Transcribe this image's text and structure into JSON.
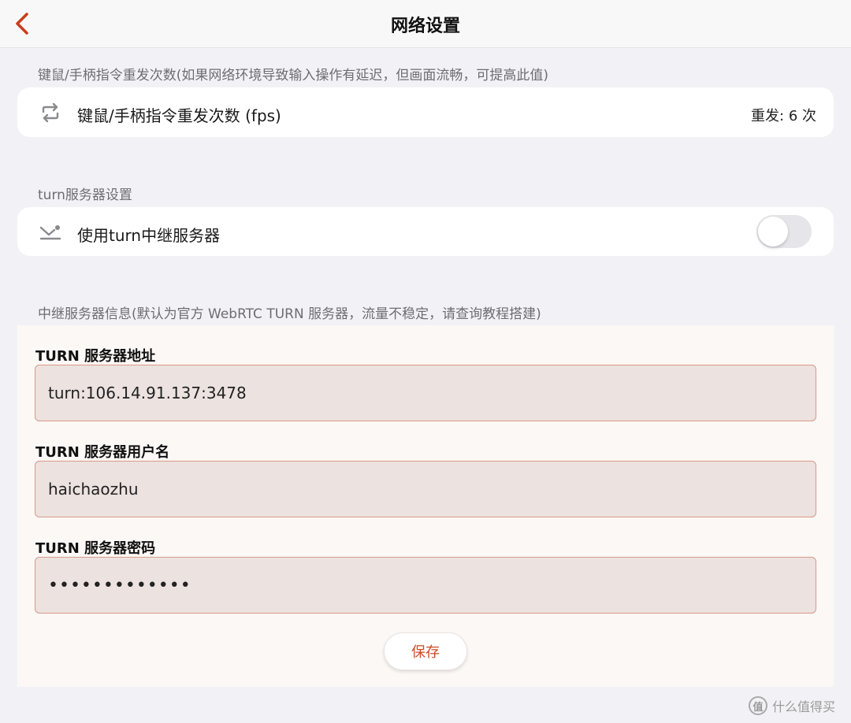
{
  "header": {
    "title": "网络设置",
    "back_icon": "chevron-left-icon",
    "accent_color": "#c8401c"
  },
  "repeat_section": {
    "caption": "键鼠/手柄指令重发次数(如果网络环境导致输入操作有延迟，但画面流畅，可提高此值)",
    "row": {
      "icon": "repeat-icon",
      "label": "键鼠/手柄指令重发次数 (fps)",
      "value": "重发: 6 次"
    }
  },
  "turn_section": {
    "caption": "turn服务器设置",
    "row": {
      "icon": "relay-icon",
      "label": "使用turn中继服务器",
      "toggle_on": false
    }
  },
  "relay_info": {
    "caption": "中继服务器信息(默认为官方 WebRTC TURN 服务器，流量不稳定，请查询教程搭建)",
    "fields": [
      {
        "label": "TURN 服务器地址",
        "value": "turn:106.14.91.137:3478"
      },
      {
        "label": "TURN 服务器用户名",
        "value": "haichaozhu"
      },
      {
        "label": "TURN 服务器密码",
        "value": "•••••••••••••"
      }
    ],
    "save_label": "保存"
  },
  "watermark": {
    "logo": "值",
    "text": "什么值得买"
  }
}
